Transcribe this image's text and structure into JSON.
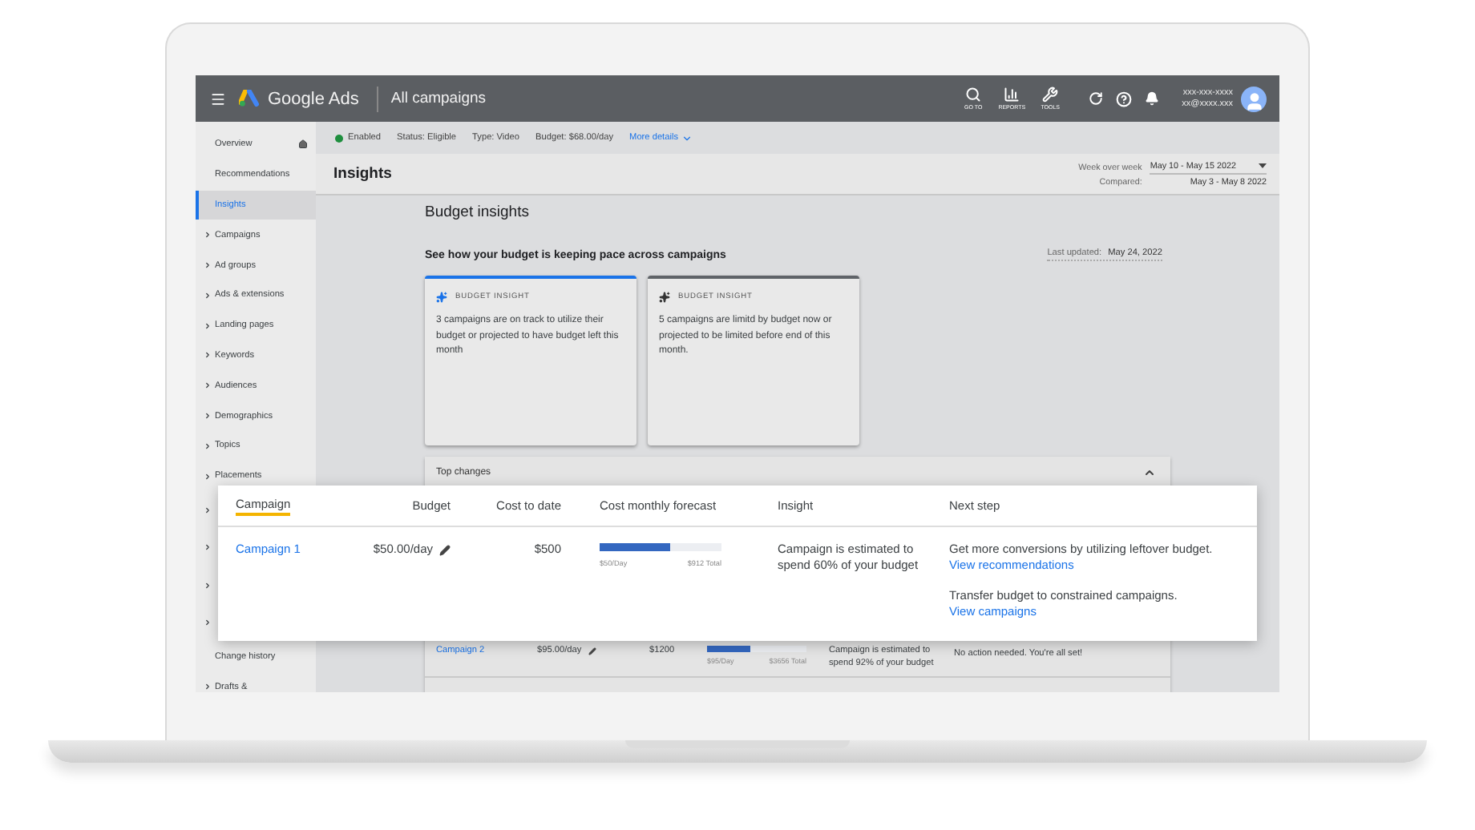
{
  "topbar": {
    "product": "Google Ads",
    "title": "All campaigns",
    "tools": [
      {
        "kind": "search",
        "label": "GO TO"
      },
      {
        "kind": "reports",
        "label": "REPORTS"
      },
      {
        "kind": "tools",
        "label": "TOOLS"
      }
    ],
    "account": {
      "phone": "xxx-xxx-xxxx",
      "email": "xx@xxxx.xxx"
    }
  },
  "sidebar": {
    "items": [
      {
        "label": "Overview",
        "expandable": false,
        "selected": false,
        "home": true
      },
      {
        "label": "Recommendations",
        "expandable": false,
        "selected": false
      },
      {
        "label": "Insights",
        "expandable": false,
        "selected": true
      },
      {
        "label": "Campaigns",
        "expandable": true,
        "selected": false
      },
      {
        "label": "Ad groups",
        "expandable": true,
        "selected": false
      },
      {
        "label": "Ads & extensions",
        "expandable": true,
        "selected": false
      },
      {
        "label": "Landing pages",
        "expandable": true,
        "selected": false
      },
      {
        "label": "Keywords",
        "expandable": true,
        "selected": false
      },
      {
        "label": "Audiences",
        "expandable": true,
        "selected": false
      },
      {
        "label": "Demographics",
        "expandable": true,
        "selected": false
      },
      {
        "label": "Topics",
        "expandable": true,
        "selected": false
      },
      {
        "label": "Placements",
        "expandable": true,
        "selected": false
      },
      {
        "expandable": true,
        "selected": false
      },
      {
        "expandable": true,
        "selected": false
      },
      {
        "expandable": true,
        "selected": false
      },
      {
        "expandable": true,
        "selected": false
      },
      {
        "label": "Change history",
        "expandable": false,
        "selected": false
      },
      {
        "label": "Drafts &",
        "expandable": true,
        "selected": false
      }
    ]
  },
  "status_bar": {
    "state": "Enabled",
    "status": "Status: Eligible",
    "type": "Type: Video",
    "budget": "Budget: $68.00/day",
    "more": "More details"
  },
  "header": {
    "title": "Insights",
    "period_label": "Week over week",
    "period": "May 10 - May 15 2022",
    "compared_label": "Compared:",
    "compared": "May 3 - May 8 2022"
  },
  "budget_insights": {
    "title": "Budget insights",
    "subtitle": "See how your budget is keeping pace across campaigns",
    "updated_label": "Last updated:",
    "updated": "May 24, 2022",
    "cards": [
      {
        "label": "BUDGET INSIGHT",
        "text": "3 campaigns are on track to utilize their budget or projected to have budget left this month",
        "selected": true
      },
      {
        "label": "BUDGET INSIGHT",
        "text": "5 campaigns are limitd by budget now or projected to be limited before end of this month.",
        "selected": false
      }
    ]
  },
  "top_changes": {
    "title": "Top changes",
    "expanded": true,
    "rows": [
      {
        "campaign": "Campaign 2",
        "budget": "$95.00/day",
        "cost": "$1200",
        "level": 0.43,
        "daily": "$95/Day",
        "total": "$3656 Total",
        "insight": "Campaign is estimated to spend 92% of your budget",
        "next_steps": [
          {
            "text": "No action needed. You're all set!"
          }
        ]
      }
    ]
  },
  "popout": {
    "columns": [
      {
        "label": "Campaign",
        "sorted": true
      },
      {
        "label": "Budget",
        "sorted": false
      },
      {
        "label": "Cost to date",
        "sorted": false
      },
      {
        "label": "Cost monthly forecast",
        "sorted": false
      },
      {
        "label": "Insight",
        "sorted": false
      },
      {
        "label": "Next step",
        "sorted": false
      }
    ],
    "rows": [
      {
        "campaign": "Campaign 1",
        "budget": "$50.00/day",
        "cost": "$500",
        "level": 0.58,
        "daily": "$50/Day",
        "total": "$912 Total",
        "insight": "Campaign is estimated to spend 60% of your budget",
        "next_steps": [
          {
            "text": "Get more conversions by utilizing leftover budget.",
            "link": "View recommendations"
          },
          {
            "text": "Transfer budget to constrained campaigns.",
            "link": "View campaigns"
          }
        ]
      }
    ]
  }
}
